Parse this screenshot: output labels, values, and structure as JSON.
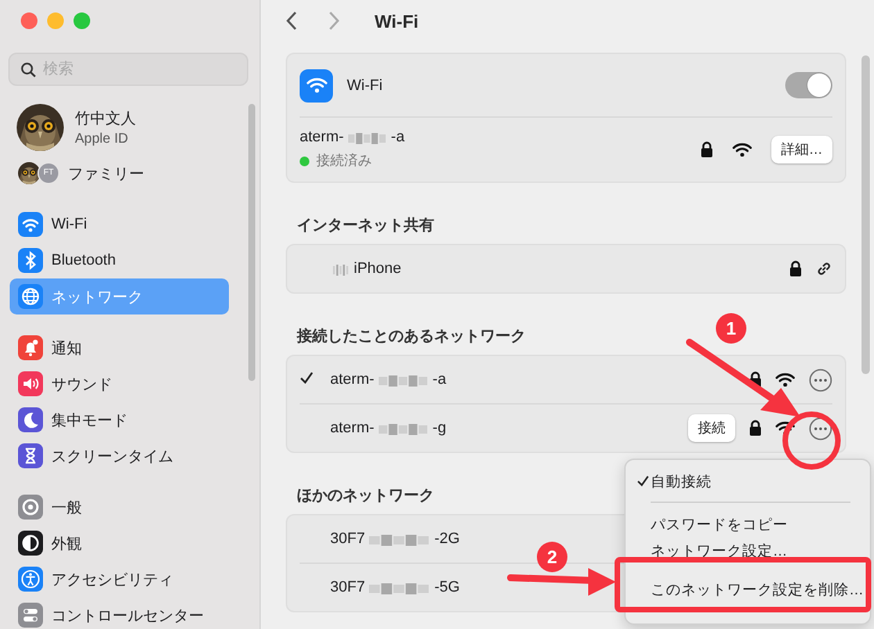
{
  "sidebar": {
    "search": {
      "placeholder": "検索"
    },
    "account": {
      "name": "竹中文人",
      "subtitle": "Apple ID"
    },
    "family": {
      "label": "ファミリー",
      "badge": "FT"
    },
    "sections": [
      {
        "items": [
          {
            "label": "Wi-Fi",
            "selected": false
          },
          {
            "label": "Bluetooth",
            "selected": false
          },
          {
            "label": "ネットワーク",
            "selected": true
          }
        ]
      },
      {
        "items": [
          {
            "label": "通知",
            "selected": false
          },
          {
            "label": "サウンド",
            "selected": false
          },
          {
            "label": "集中モード",
            "selected": false
          },
          {
            "label": "スクリーンタイム",
            "selected": false
          }
        ]
      },
      {
        "items": [
          {
            "label": "一般",
            "selected": false
          },
          {
            "label": "外観",
            "selected": false
          },
          {
            "label": "アクセシビリティ",
            "selected": false
          },
          {
            "label": "コントロールセンター",
            "selected": false
          }
        ]
      }
    ]
  },
  "header": {
    "title": "Wi-Fi"
  },
  "wifi": {
    "label": "Wi-Fi",
    "on": true
  },
  "current_network": {
    "name_start": "aterm-",
    "name_end": "-a",
    "status": "接続済み",
    "details_button": "詳細…"
  },
  "sharing": {
    "heading": "インターネット共有",
    "device": "iPhone"
  },
  "known": {
    "heading": "接続したことのあるネットワーク",
    "networks": [
      {
        "name_start": "aterm-",
        "name_end": "-a",
        "selected": true
      },
      {
        "name_start": "aterm-",
        "name_end": "-g",
        "selected": false,
        "connect_button": "接続"
      }
    ]
  },
  "other": {
    "heading": "ほかのネットワーク",
    "networks": [
      {
        "name_start": "30F7",
        "name_end": "-2G"
      },
      {
        "name_start": "30F7",
        "name_end": "-5G"
      }
    ]
  },
  "menu": {
    "items": [
      {
        "kind": "item",
        "label": "自動接続",
        "checked": true
      },
      {
        "kind": "separator"
      },
      {
        "kind": "item",
        "label": "パスワードをコピー",
        "checked": false
      },
      {
        "kind": "item",
        "label": "ネットワーク設定…",
        "checked": false
      },
      {
        "kind": "item",
        "label": "このネットワーク設定を削除…",
        "checked": false
      }
    ]
  },
  "annotations": [
    {
      "kind": "arrow"
    },
    {
      "kind": "badge",
      "label": "1"
    },
    {
      "kind": "ring"
    },
    {
      "kind": "arrow"
    },
    {
      "kind": "badge",
      "label": "2"
    },
    {
      "kind": "frame"
    }
  ]
}
